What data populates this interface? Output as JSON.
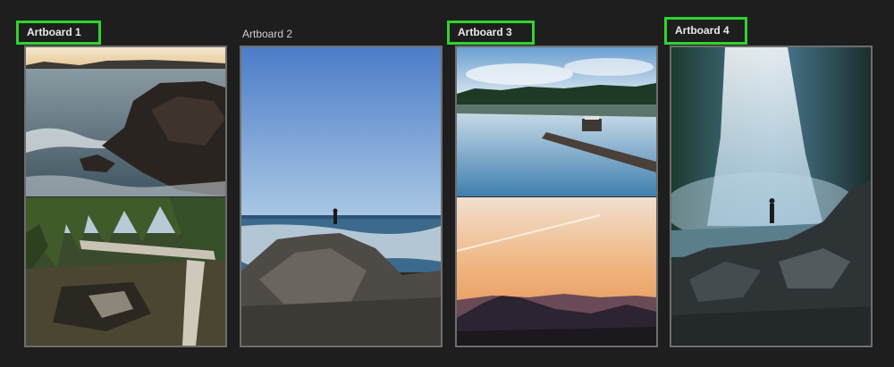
{
  "artboards": [
    {
      "label": "Artboard 1",
      "selected": true,
      "photos": [
        "rocky-coast-sunset-photo",
        "forest-driftwood-photo"
      ]
    },
    {
      "label": "Artboard 2",
      "selected": false,
      "photos": [
        "person-on-coastal-rock-photo"
      ]
    },
    {
      "label": "Artboard 3",
      "selected": true,
      "photos": [
        "lake-dock-reflection-photo",
        "mountain-sunset-photo"
      ]
    },
    {
      "label": "Artboard 4",
      "selected": true,
      "photos": [
        "waterfall-hiker-photo"
      ]
    }
  ],
  "colors": {
    "selection": "#2fd42f",
    "board_border": "#6e6e6e",
    "background": "#1e1e1e"
  }
}
